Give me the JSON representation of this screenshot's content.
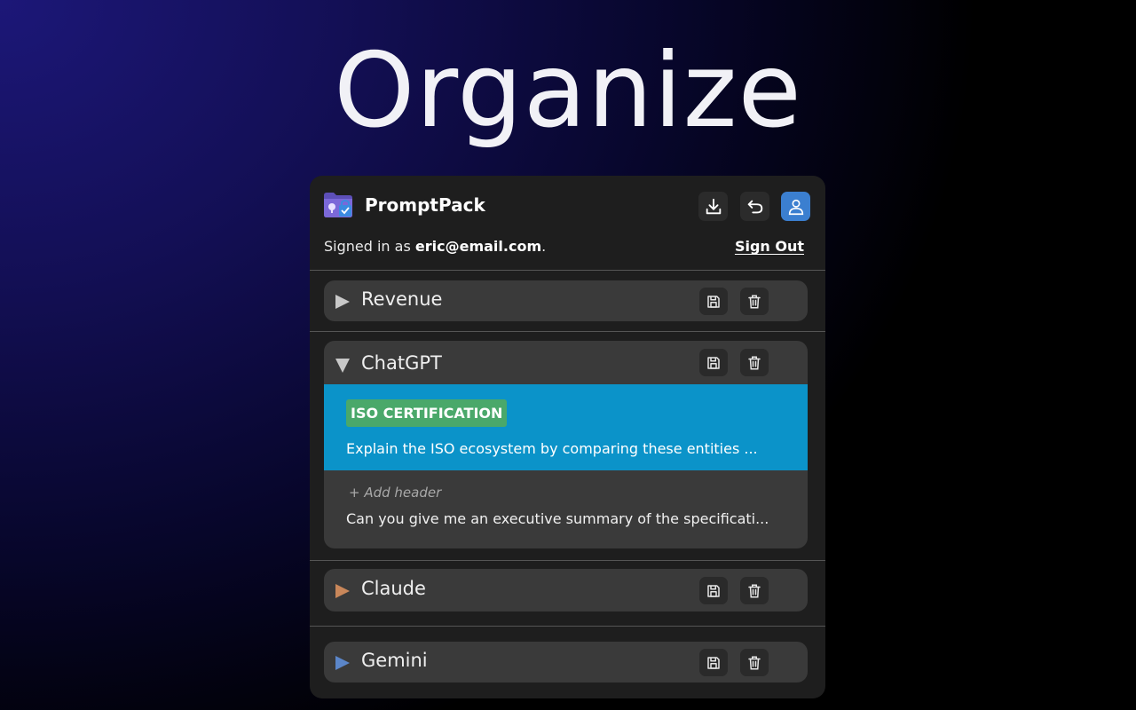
{
  "hero": {
    "title": "Organize"
  },
  "app": {
    "name": "PromptPack",
    "icons": {
      "logo": "folder-lock-logo",
      "download": "download-icon",
      "undo": "undo-icon",
      "account": "user-icon"
    },
    "accent": "#3b7fd0"
  },
  "account": {
    "signed_prefix": "Signed in as ",
    "email": "eric@email.com",
    "signed_suffix": ".",
    "sign_out": "Sign Out"
  },
  "folders": [
    {
      "name": "Revenue",
      "expanded": false,
      "color": "#c8c8c8"
    },
    {
      "name": "ChatGPT",
      "expanded": true,
      "color": "#c8c8c8",
      "prompts": [
        {
          "header": "ISO CERTIFICATION",
          "text": "Explain the ISO ecosystem by comparing these entities ...",
          "selected": true
        },
        {
          "header_placeholder": "+ Add header",
          "text": "Can you give me an executive summary of the specificati...",
          "selected": false
        }
      ]
    },
    {
      "name": "Claude",
      "expanded": false,
      "color": "#c9875a"
    },
    {
      "name": "Gemini",
      "expanded": false,
      "color": "#5b86c9"
    }
  ],
  "colors": {
    "selected_prompt_bg": "#0b93c9",
    "tag_bg": "#4aa86a"
  }
}
